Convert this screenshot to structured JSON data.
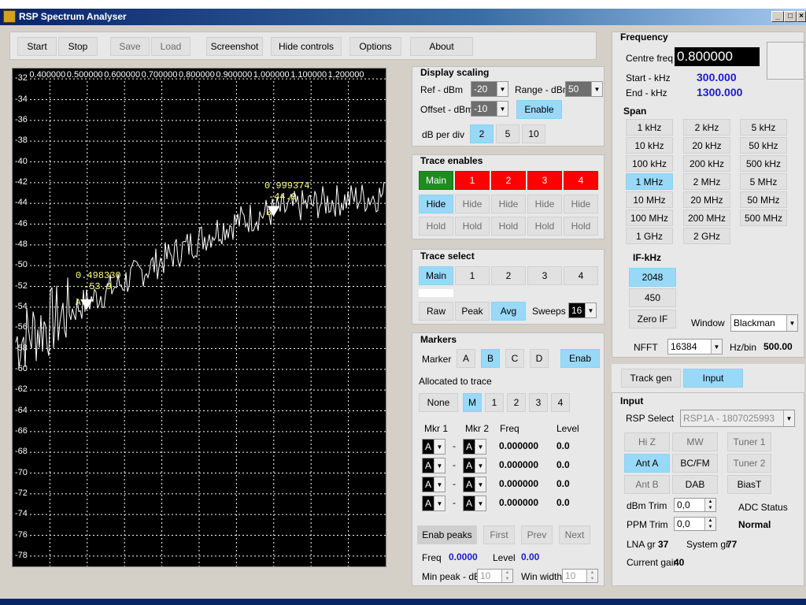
{
  "window": {
    "title": "RSP Spectrum Analyser",
    "min": "_",
    "max": "□",
    "close": "×"
  },
  "toolbar": {
    "start": "Start",
    "stop": "Stop",
    "save": "Save",
    "load": "Load",
    "screenshot": "Screenshot",
    "hide_controls": "Hide controls",
    "options": "Options",
    "about": "About"
  },
  "plot": {
    "x_ticks": [
      "0.400000",
      "0.500000",
      "0.600000",
      "0.700000",
      "0.800000",
      "0.900000",
      "1.000000",
      "1.100000",
      "1.200000"
    ],
    "y_ticks": [
      "-32",
      "-34",
      "-36",
      "-38",
      "-40",
      "-42",
      "-44",
      "-46",
      "-48",
      "-50",
      "-52",
      "-54",
      "-56",
      "-58",
      "-60",
      "-62",
      "-64",
      "-66",
      "-68",
      "-70",
      "-72",
      "-74",
      "-76",
      "-78"
    ],
    "marker_a": {
      "freq": "0.498330",
      "level": "-53.9",
      "letter": "A"
    },
    "marker_b": {
      "freq": "0.999374",
      "level": "-44.9",
      "letter": "B"
    },
    "trace_color": "#ffffff",
    "grid_color": "#ffffff",
    "bg": "#000000"
  },
  "chart_data": {
    "type": "line",
    "x_unit": "MHz",
    "y_unit": "dBm",
    "xlim": [
      0.3,
      1.3
    ],
    "ylim": [
      -79,
      -31
    ],
    "x_ticks": [
      0.4,
      0.5,
      0.6,
      0.7,
      0.8,
      0.9,
      1.0,
      1.1,
      1.2
    ],
    "y_ticks": [
      -32,
      -34,
      -36,
      -38,
      -40,
      -42,
      -44,
      -46,
      -48,
      -50,
      -52,
      -54,
      -56,
      -58,
      -60,
      -62,
      -64,
      -66,
      -68,
      -70,
      -72,
      -74,
      -76,
      -78
    ],
    "series": [
      {
        "x": [
          0.3,
          0.35,
          0.4,
          0.45,
          0.5,
          0.55,
          0.6,
          0.65,
          0.7,
          0.75,
          0.8,
          0.85,
          0.9,
          0.95,
          1.0,
          1.05,
          1.1,
          1.15,
          1.2,
          1.25,
          1.3
        ],
        "values": [
          -57.5,
          -56.5,
          -55.5,
          -54.5,
          -53.5,
          -52.5,
          -51.5,
          -50.5,
          -49.5,
          -48.5,
          -47.5,
          -46.5,
          -45.8,
          -45.2,
          -44.8,
          -44.4,
          -44.1,
          -43.8,
          -43.6,
          -43.4,
          -43.2
        ]
      }
    ],
    "markers": [
      {
        "label": "A",
        "x": 0.49833,
        "y": -53.9
      },
      {
        "label": "B",
        "x": 0.999374,
        "y": -44.9
      }
    ]
  },
  "display_scaling": {
    "title": "Display scaling",
    "ref_label": "Ref - dBm",
    "ref": "-20",
    "range_label": "Range - dBm",
    "range": "50",
    "offset_label": "Offset - dBm",
    "offset": "-10",
    "enable": "Enable",
    "dbdiv_label": "dB per div",
    "dbdiv": [
      "2",
      "5",
      "10"
    ]
  },
  "trace_enables": {
    "title": "Trace enables",
    "cols": [
      "Main",
      "1",
      "2",
      "3",
      "4"
    ],
    "hide": "Hide",
    "hold": "Hold"
  },
  "trace_select": {
    "title": "Trace select",
    "cols": [
      "Main",
      "1",
      "2",
      "3",
      "4"
    ],
    "raw": "Raw",
    "peak": "Peak",
    "avg": "Avg",
    "sweeps_label": "Sweeps",
    "sweeps": "16"
  },
  "markers": {
    "title": "Markers",
    "marker_label": "Marker",
    "letters": [
      "A",
      "B",
      "C",
      "D"
    ],
    "enab": "Enab",
    "alloc_label": "Allocated to trace",
    "alloc": [
      "None",
      "M",
      "1",
      "2",
      "3",
      "4"
    ],
    "mkr1_head": "Mkr 1",
    "mkr2_head": "Mkr 2",
    "freq_head": "Freq",
    "level_head": "Level",
    "rows": [
      {
        "m1": "A",
        "m2": "A",
        "freq": "0.000000",
        "level": "0.0"
      },
      {
        "m1": "A",
        "m2": "A",
        "freq": "0.000000",
        "level": "0.0"
      },
      {
        "m1": "A",
        "m2": "A",
        "freq": "0.000000",
        "level": "0.0"
      },
      {
        "m1": "A",
        "m2": "A",
        "freq": "0.000000",
        "level": "0.0"
      }
    ],
    "dash": "-",
    "enab_peaks": "Enab peaks",
    "first": "First",
    "prev": "Prev",
    "next": "Next",
    "freq_label": "Freq",
    "freq_val": "0.0000",
    "level_label": "Level",
    "level_val": "0.00",
    "minpeak_label": "Min peak - dB",
    "minpeak": "10",
    "winwidth_label": "Win width",
    "winwidth": "10"
  },
  "frequency": {
    "title": "Frequency",
    "centre_label": "Centre freq",
    "centre": "0.800000",
    "start_label": "Start - kHz",
    "start": "300.000",
    "end_label": "End - kHz",
    "end": "1300.000",
    "span_title": "Span",
    "spans": [
      "1 kHz",
      "2 kHz",
      "5 kHz",
      "10 kHz",
      "20 kHz",
      "50 kHz",
      "100 kHz",
      "200 kHz",
      "500 kHz",
      "1 MHz",
      "2 MHz",
      "5 MHz",
      "10 MHz",
      "20 MHz",
      "50 MHz",
      "100 MHz",
      "200 MHz",
      "500 MHz",
      "1 GHz",
      "2 GHz"
    ],
    "if_title": "IF-kHz",
    "if": [
      "2048",
      "450",
      "Zero IF"
    ],
    "window_label": "Window",
    "window": "Blackman",
    "nfft_label": "NFFT",
    "nfft": "16384",
    "hzbin_label": "Hz/bin",
    "hzbin": "500.00"
  },
  "tabs": {
    "track_gen": "Track gen",
    "input": "Input"
  },
  "input": {
    "title": "Input",
    "rsp_label": "RSP Select",
    "rsp": "RSP1A - 1807025993",
    "btns": [
      "Hi Z",
      "MW",
      "Tuner 1",
      "Ant A",
      "BC/FM",
      "Tuner 2",
      "Ant B",
      "DAB",
      "BiasT"
    ],
    "dbm_trim_label": "dBm Trim",
    "dbm_trim": "0,0",
    "ppm_trim_label": "PPM Trim",
    "ppm_trim": "0,0",
    "adc_label": "ADC Status",
    "adc": "Normal",
    "lna_label": "LNA gr",
    "lna": "37",
    "sys_label": "System gr",
    "sys": "77",
    "gain_label": "Current gain",
    "gain": "40"
  }
}
